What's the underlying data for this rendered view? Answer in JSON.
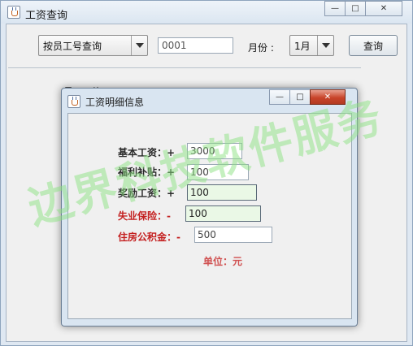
{
  "outer_window": {
    "title": "工资查询",
    "controls": {
      "minimize": "—",
      "maximize": "□",
      "close": "✕"
    }
  },
  "query_bar": {
    "mode_combo": {
      "selected": "按员工号查询"
    },
    "employee_id_input": {
      "value": "0001"
    },
    "month_label": "月份 :",
    "month_combo": {
      "selected": "1月"
    },
    "query_button_label": "查询"
  },
  "background_hint": "员工工资",
  "detail_dialog": {
    "title": "工资明细信息",
    "controls": {
      "minimize": "—",
      "maximize": "□",
      "close": "✕"
    },
    "fields": [
      {
        "label": "基本工资：+",
        "value": "3000",
        "style": "normal"
      },
      {
        "label": "福利补贴：+",
        "value": "100",
        "style": "normal"
      },
      {
        "label": "奖励工资：+",
        "value": "100",
        "style": "highlight"
      },
      {
        "label": "失业保险：-",
        "value": "100",
        "style": "red-highlight"
      },
      {
        "label": "住房公积金：-",
        "value": "500",
        "style": "red"
      }
    ],
    "unit_note": "单位：元"
  },
  "watermark": "边界科技软件服务",
  "colors": {
    "title_bar": "#dbe6f1",
    "close_red": "#c8442a",
    "deduction_label": "#c42020",
    "highlight_input": "#eaf8e6",
    "unit_note": "#d05050"
  }
}
